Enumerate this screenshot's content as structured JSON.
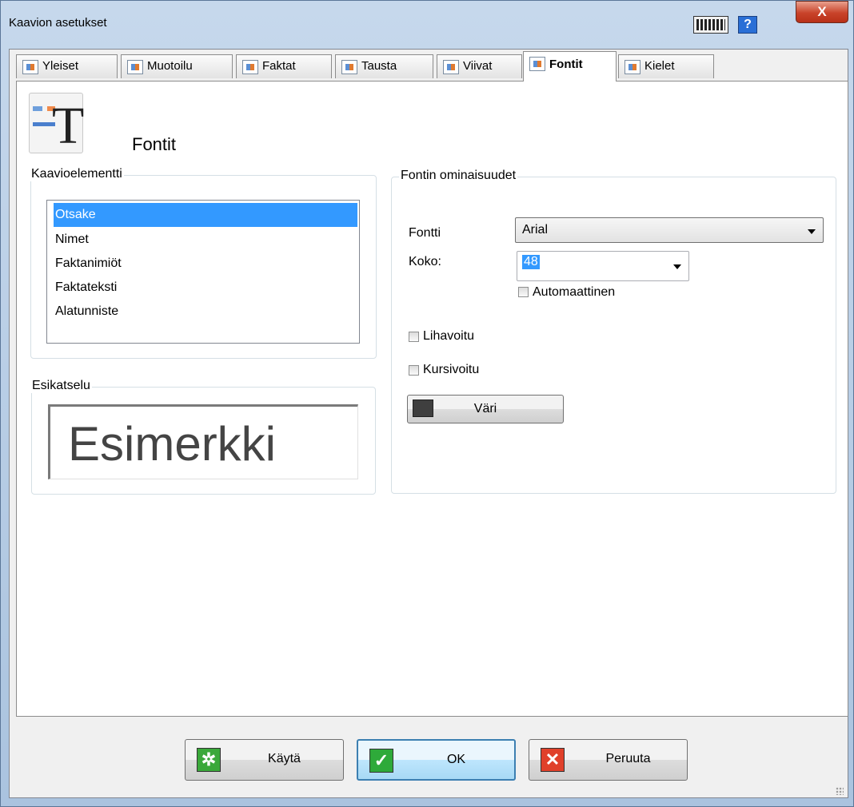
{
  "window": {
    "title": "Kaavion asetukset",
    "help_label": "?",
    "close_label": "X"
  },
  "tabs": [
    {
      "label": "Yleiset"
    },
    {
      "label": "Muotoilu"
    },
    {
      "label": "Faktat"
    },
    {
      "label": "Tausta"
    },
    {
      "label": "Viivat"
    },
    {
      "label": "Fontit",
      "active": true
    },
    {
      "label": "Kielet"
    }
  ],
  "header": {
    "title": "Fontit",
    "icon": "fonts-icon"
  },
  "element_group": {
    "label": "Kaavioelementti",
    "items": [
      "Otsake",
      "Nimet",
      "Faktanimiöt",
      "Faktateksti",
      "Alatunniste"
    ],
    "selected_index": 0
  },
  "preview_group": {
    "label": "Esikatselu",
    "sample_text": "Esimerkki"
  },
  "font_group": {
    "label": "Fontin ominaisuudet",
    "font_label": "Fontti",
    "font_value": "Arial",
    "size_label": "Koko:",
    "size_value": "48",
    "auto_label": "Automaattinen",
    "bold_label": "Lihavoitu",
    "italic_label": "Kursivoitu",
    "color_button_label": "Väri",
    "color_value": "#3f3f3f"
  },
  "footer": {
    "apply_label": "Käytä",
    "ok_label": "OK",
    "cancel_label": "Peruuta"
  },
  "colors": {
    "selection": "#3399ff",
    "ok_icon": "#2eaa3a",
    "cancel_icon": "#e0402a",
    "apply_icon": "#3aa83a"
  }
}
